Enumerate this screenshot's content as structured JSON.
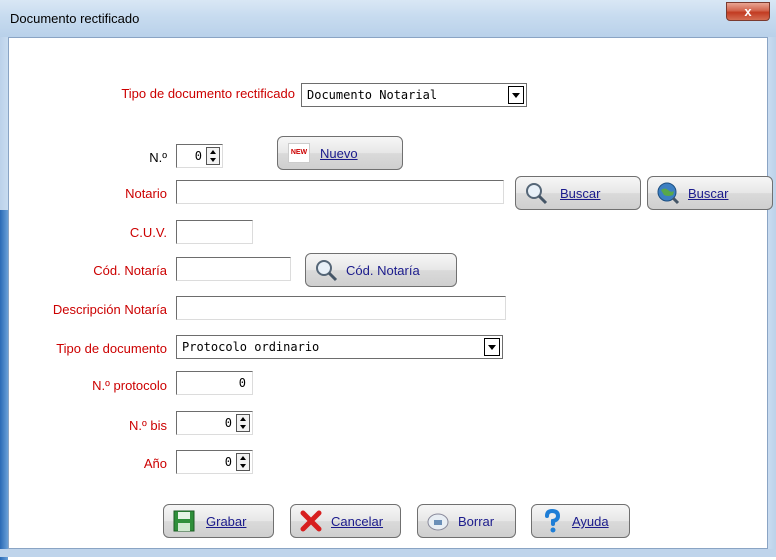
{
  "window": {
    "title": "Documento rectificado",
    "close_label": "x"
  },
  "form": {
    "tipo_doc_rect": {
      "label": "Tipo de documento rectificado",
      "value": "Documento Notarial"
    },
    "numero": {
      "label": "N.º",
      "value": "0"
    },
    "nuevo_button": {
      "label": "Nuevo",
      "icon_text": "NEW"
    },
    "notario": {
      "label": "Notario",
      "value": ""
    },
    "buscar_button": {
      "label": "Buscar"
    },
    "buscar_web_button": {
      "label": "Buscar"
    },
    "cuv": {
      "label": "C.U.V.",
      "value": ""
    },
    "cod_notaria": {
      "label": "Cód. Notaría",
      "value": ""
    },
    "cod_notaria_button": {
      "label": "Cód. Notaría"
    },
    "descripcion_notaria": {
      "label": "Descripción Notaría",
      "value": ""
    },
    "tipo_documento": {
      "label": "Tipo de documento",
      "value": "Protocolo ordinario"
    },
    "num_protocolo": {
      "label": "N.º protocolo",
      "value": "0"
    },
    "num_bis": {
      "label": "N.º bis",
      "value": "0"
    },
    "anio": {
      "label": "Año",
      "value": "0"
    }
  },
  "footer": {
    "grabar": "Grabar",
    "cancelar": "Cancelar",
    "borrar": "Borrar",
    "ayuda": "Ayuda"
  }
}
